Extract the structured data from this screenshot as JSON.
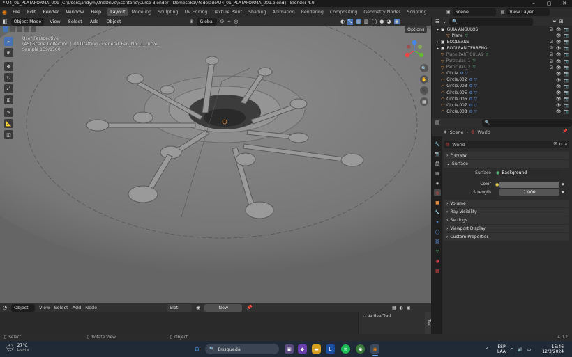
{
  "titlebar": {
    "title": "* U4_01_PLATAFORMA_001 [C:\\Users\\andym\\OneDrive\\Escritorio\\Curso Blender - Doméstika\\Modelado\\U4_01_PLATAFORMA_001.blend] - Blender 4.0"
  },
  "menu": {
    "items": [
      "File",
      "Edit",
      "Render",
      "Window",
      "Help"
    ]
  },
  "workspaces": [
    "Layout",
    "Modeling",
    "Sculpting",
    "UV Editing",
    "Texture Paint",
    "Shading",
    "Animation",
    "Rendering",
    "Compositing",
    "Geometry Nodes",
    "Scripting"
  ],
  "scene": {
    "label": "Scene",
    "view_layer": "View Layer"
  },
  "viewport": {
    "mode": "Object Mode",
    "menus": [
      "View",
      "Select",
      "Add",
      "Object"
    ],
    "transform": "Global",
    "options": "Options",
    "info_line1": "User Perspective",
    "info_line2": "(45) Scene Collection | 2D Drafting - General_Pen_No._1_curve_",
    "info_line3": "Sample 139/1500"
  },
  "shader_editor": {
    "mode": "Object",
    "menus": [
      "View",
      "Select",
      "Add",
      "Node"
    ],
    "slot": "Slot",
    "new": "New",
    "active_tool": "Active Tool",
    "side_tab": "Tool"
  },
  "outliner": {
    "rows": [
      {
        "name": "GUIA ANGULOS",
        "indent": 0,
        "dim": false,
        "icons": "collection"
      },
      {
        "name": "Plane",
        "indent": 1,
        "dim": false,
        "icons": "mesh"
      },
      {
        "name": "BOOLEANS",
        "indent": 0,
        "dim": false,
        "icons": "collection"
      },
      {
        "name": "BOOLEAN TERRENO",
        "indent": 0,
        "dim": false,
        "icons": "collection"
      },
      {
        "name": "Plano PARTICULAS",
        "indent": 0,
        "dim": true,
        "icons": "mesh"
      },
      {
        "name": "Particulas_1",
        "indent": 0,
        "dim": true,
        "icons": "mesh"
      },
      {
        "name": "Particulas_2",
        "indent": 0,
        "dim": true,
        "icons": "mesh"
      },
      {
        "name": "Circle",
        "indent": 0,
        "dim": false,
        "icons": "curve"
      },
      {
        "name": "Circle.002",
        "indent": 0,
        "dim": false,
        "icons": "curve"
      },
      {
        "name": "Circle.003",
        "indent": 0,
        "dim": false,
        "icons": "curve"
      },
      {
        "name": "Circle.005",
        "indent": 0,
        "dim": false,
        "icons": "curve"
      },
      {
        "name": "Circle.006",
        "indent": 0,
        "dim": false,
        "icons": "curve"
      },
      {
        "name": "Circle.007",
        "indent": 0,
        "dim": false,
        "icons": "curve"
      },
      {
        "name": "Circle.008",
        "indent": 0,
        "dim": false,
        "icons": "curve"
      }
    ]
  },
  "properties": {
    "breadcrumb_scene": "Scene",
    "breadcrumb_world": "World",
    "world_name": "World",
    "panels": {
      "preview": "Preview",
      "surface": "Surface",
      "volume": "Volume",
      "ray_visibility": "Ray Visibility",
      "settings": "Settings",
      "viewport_display": "Viewport Display",
      "custom_properties": "Custom Properties"
    },
    "surface_label": "Surface",
    "surface_value": "Background",
    "color_label": "Color",
    "strength_label": "Strength",
    "strength_value": "1.000",
    "version": "4.0.2"
  },
  "statusbar": {
    "select": "Select",
    "rotate": "Rotate View",
    "object": "Object"
  },
  "taskbar": {
    "weather_temp": "27°C",
    "weather_text": "Lluvia",
    "search": "Búsqueda",
    "lang1": "ESP",
    "lang2": "LAA",
    "time": "15:46",
    "date": "12/3/2024"
  },
  "colors": {
    "accent": "#4772b3",
    "orange": "#e08a3c",
    "green": "#4fb06d"
  }
}
